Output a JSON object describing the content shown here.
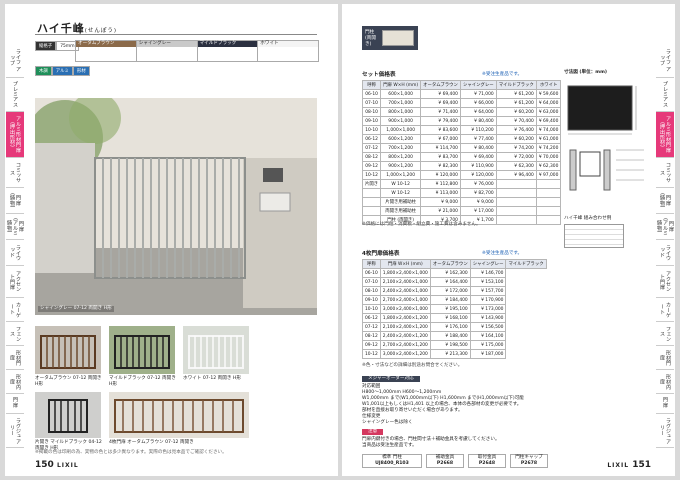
{
  "left": {
    "title": "ハイ千峰",
    "title_reading": "(せんぽう)",
    "tabs": [
      "ライフ アップ",
      "プレミアス",
      "アルミ形材門扉 (押出形材)",
      "コミッサス",
      "門扉 (鋳物)",
      "門扉 (アルミ鋳物)",
      "ライウッド",
      "アクセント門扉",
      "カーゲート",
      "フェンス",
      "形材門扉",
      "形材内扉",
      "門扉",
      "ラグジュアリー"
    ],
    "spec_chips": [
      "縦格子",
      "75ｍｍ",
      "木調",
      "アルミ",
      "形材"
    ],
    "colors_header": [
      "オータムブラウン",
      "シャイングレー",
      "マイルドブラック",
      "ホワイト"
    ],
    "main_caption": "シャイングレー  07-12  両開き  H形",
    "thumbs": [
      {
        "caption": "オータムブラウン  07-12  両開き  H形"
      },
      {
        "caption": "マイルドブラック  07-12  両開き  H形"
      },
      {
        "caption": "ホワイト  07-12  両開き  H形"
      }
    ],
    "thumbs2": [
      {
        "caption": "片開き  マイルドブラック  04-12  両開き  H形"
      },
      {
        "caption": "4枚門扉  オータムブラウン  07-12  両開き"
      }
    ],
    "page_num": "150",
    "brand": "LIXIL",
    "footnote": "※掲載の色は印刷の為、実物の色とは多少異なります。実際の色は見本品でご確認ください。"
  },
  "right": {
    "page_num": "151",
    "brand": "LIXIL",
    "tabs": [
      "ライフ アップ",
      "プレミアス",
      "アルミ形材門扉 (押出形材)",
      "コミッサス",
      "門扉 (鋳物)",
      "門扉 (アルミ鋳物)",
      "ライウッド",
      "アクセント門扉",
      "カーゲート",
      "フェンス",
      "形材門扉",
      "形材内扉",
      "門扉",
      "ラグジュアリー"
    ],
    "set_title": "セット価格表",
    "set_note": "※受注生産品です。",
    "set_headers": [
      "呼称",
      "門扉 W×H (mm)",
      "オータムブラウン",
      "シャイングレー",
      "マイルドブラック",
      "ホワイト"
    ],
    "set_rows": [
      [
        "06-10",
        "600×1,000",
        "¥ 69,400",
        "¥ 71,000",
        "¥ 61,200",
        "¥ 59,600"
      ],
      [
        "07-10",
        "700×1,000",
        "¥ 69,400",
        "¥ 66,000",
        "¥ 61,200",
        "¥ 64,000"
      ],
      [
        "08-10",
        "800×1,000",
        "¥ 71,400",
        "¥ 64,000",
        "¥ 60,200",
        "¥ 63,000"
      ],
      [
        "09-10",
        "900×1,000",
        "¥ 79,400",
        "¥ 80,400",
        "¥ 70,400",
        "¥ 69,400"
      ],
      [
        "10-10",
        "1,000×1,000",
        "¥ 83,600",
        "¥ 110,200",
        "¥ 76,400",
        "¥ 74,000"
      ],
      [
        "06-12",
        "600×1,200",
        "¥ 67,000",
        "¥ 77,400",
        "¥ 60,200",
        "¥ 61,000"
      ],
      [
        "07-12",
        "700×1,200",
        "¥ 114,700",
        "¥ 80,400",
        "¥ 74,200",
        "¥ 74,200"
      ],
      [
        "08-12",
        "800×1,200",
        "¥ 83,700",
        "¥ 69,400",
        "¥ 72,000",
        "¥ 70,000"
      ],
      [
        "09-12",
        "900×1,200",
        "¥ 82,300",
        "¥ 110,900",
        "¥ 62,300",
        "¥ 62,300"
      ],
      [
        "10-12",
        "1,000×1,200",
        "¥ 120,000",
        "¥ 120,000",
        "¥ 96,400",
        "¥ 97,000"
      ],
      [
        "片開き",
        "W 10-12",
        "¥ 112,800",
        "¥ 76,000",
        "",
        ""
      ],
      [
        "",
        "W 10-12",
        "¥ 113,000",
        "¥ 82,700",
        "",
        ""
      ],
      [
        "",
        "片開き用補助柱",
        "¥ 9,000",
        "¥ 9,000",
        "",
        ""
      ],
      [
        "",
        "両開き用補助柱",
        "¥ 21,000",
        "¥ 17,000",
        "",
        ""
      ],
      [
        "",
        "門柱 (両開き)",
        "¥ 3,700",
        "¥ 1,700",
        "",
        ""
      ]
    ],
    "set_footnote": "※価格には門柱・消費税・組立費・施工費は含みません。",
    "door_title": "4枚門扉価格表",
    "door_note": "※受注生産品です。",
    "door_headers": [
      "呼称",
      "門扉 W×H (mm)",
      "オータムブラウン",
      "シャイングレー",
      "マイルドブラック"
    ],
    "door_rows": [
      [
        "06-10",
        "1,800×2,400×1,000",
        "¥ 162,300",
        "¥ 146,700"
      ],
      [
        "07-10",
        "2,100×2,400×1,000",
        "¥ 164,400",
        "¥ 153,100"
      ],
      [
        "08-10",
        "2,400×2,400×1,000",
        "¥ 172,000",
        "¥ 157,700"
      ],
      [
        "09-10",
        "2,700×2,400×1,000",
        "¥ 184,400",
        "¥ 170,900"
      ],
      [
        "10-10",
        "3,000×2,400×1,000",
        "¥ 195,100",
        "¥ 173,000"
      ],
      [
        "06-12",
        "1,800×2,400×1,200",
        "¥ 168,100",
        "¥ 143,900"
      ],
      [
        "07-12",
        "2,100×2,400×1,200",
        "¥ 176,100",
        "¥ 156,500"
      ],
      [
        "08-12",
        "2,400×2,400×1,200",
        "¥ 188,400",
        "¥ 164,100"
      ],
      [
        "09-12",
        "2,700×2,400×1,200",
        "¥ 198,500",
        "¥ 175,000"
      ],
      [
        "10-12",
        "3,000×2,400×1,200",
        "¥ 213,300",
        "¥ 187,000"
      ]
    ],
    "door_footnote": "※色・寸法などの詳細は別途お問合せください。",
    "made_title": "メジャーオーダー対応",
    "made_lines": [
      "対応範囲",
      "H800〜1,000mm H600〜1,200mm",
      "W1,000mm まで(W1,000mm以下) H1,600mm まで(H1,000mm以下)可能",
      "W1,001以上もしくはH1,401 以上の場合、本体の各部材の変更が必要です。",
      "部材を直接お取り寄せいただく場合があります。",
      "仕様変更",
      "シャイングレー色は除く"
    ],
    "note_title": "注意",
    "note_lines": [
      "門扉内鍵付きの場合、門柱間寸法＋補助金具を考慮してください。",
      "当商品は受注生産品です。"
    ],
    "dim_title": "寸法図",
    "dim_unit": "(単位：mm)",
    "spec_label": "ハイ千峰 組み合わせ例",
    "bottom_codes": [
      {
        "label": "標準 門柱",
        "code": "UJ8400_R103"
      },
      {
        "label": "補助金具",
        "code": "P2668"
      },
      {
        "label": "取付金具",
        "code": "P2648"
      },
      {
        "label": "門柱キャップ",
        "code": "P2678"
      }
    ],
    "inset_label": "門柱 (両開き)"
  }
}
